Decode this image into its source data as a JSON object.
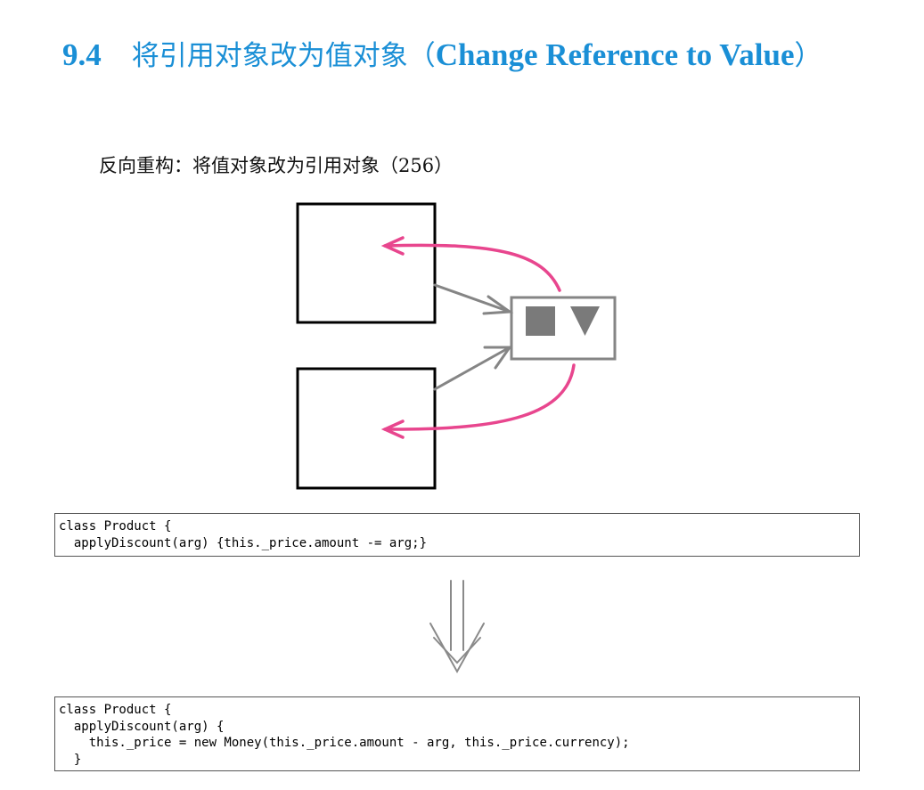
{
  "section": {
    "number": "9.4",
    "title_cn": "将引用对象改为值对象",
    "title_en_open": "（",
    "title_en": "Change Reference to Value",
    "title_en_close": "）"
  },
  "inverse_refactoring": "反向重构：将值对象改为引用对象（256）",
  "code_before": "class Product {\n  applyDiscount(arg) {this._price.amount -= arg;}",
  "code_after": "class Product {\n  applyDiscount(arg) {\n    this._price = new Money(this._price.amount - arg, this._price.currency);\n  }",
  "colors": {
    "heading": "#1a8fd6",
    "pink_arrow": "#e8468e",
    "gray_arrow": "#858585",
    "box_border": "#000000"
  },
  "icons": [
    "square-icon",
    "triangle-down-icon",
    "double-down-arrow-icon"
  ]
}
